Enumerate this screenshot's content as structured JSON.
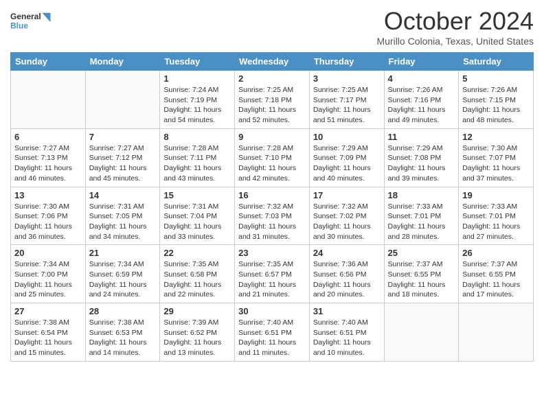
{
  "header": {
    "logo_general": "General",
    "logo_blue": "Blue",
    "month_title": "October 2024",
    "location": "Murillo Colonia, Texas, United States"
  },
  "days_of_week": [
    "Sunday",
    "Monday",
    "Tuesday",
    "Wednesday",
    "Thursday",
    "Friday",
    "Saturday"
  ],
  "weeks": [
    [
      {
        "day": null,
        "sunrise": null,
        "sunset": null,
        "daylight": null
      },
      {
        "day": null,
        "sunrise": null,
        "sunset": null,
        "daylight": null
      },
      {
        "day": "1",
        "sunrise": "Sunrise: 7:24 AM",
        "sunset": "Sunset: 7:19 PM",
        "daylight": "Daylight: 11 hours and 54 minutes."
      },
      {
        "day": "2",
        "sunrise": "Sunrise: 7:25 AM",
        "sunset": "Sunset: 7:18 PM",
        "daylight": "Daylight: 11 hours and 52 minutes."
      },
      {
        "day": "3",
        "sunrise": "Sunrise: 7:25 AM",
        "sunset": "Sunset: 7:17 PM",
        "daylight": "Daylight: 11 hours and 51 minutes."
      },
      {
        "day": "4",
        "sunrise": "Sunrise: 7:26 AM",
        "sunset": "Sunset: 7:16 PM",
        "daylight": "Daylight: 11 hours and 49 minutes."
      },
      {
        "day": "5",
        "sunrise": "Sunrise: 7:26 AM",
        "sunset": "Sunset: 7:15 PM",
        "daylight": "Daylight: 11 hours and 48 minutes."
      }
    ],
    [
      {
        "day": "6",
        "sunrise": "Sunrise: 7:27 AM",
        "sunset": "Sunset: 7:13 PM",
        "daylight": "Daylight: 11 hours and 46 minutes."
      },
      {
        "day": "7",
        "sunrise": "Sunrise: 7:27 AM",
        "sunset": "Sunset: 7:12 PM",
        "daylight": "Daylight: 11 hours and 45 minutes."
      },
      {
        "day": "8",
        "sunrise": "Sunrise: 7:28 AM",
        "sunset": "Sunset: 7:11 PM",
        "daylight": "Daylight: 11 hours and 43 minutes."
      },
      {
        "day": "9",
        "sunrise": "Sunrise: 7:28 AM",
        "sunset": "Sunset: 7:10 PM",
        "daylight": "Daylight: 11 hours and 42 minutes."
      },
      {
        "day": "10",
        "sunrise": "Sunrise: 7:29 AM",
        "sunset": "Sunset: 7:09 PM",
        "daylight": "Daylight: 11 hours and 40 minutes."
      },
      {
        "day": "11",
        "sunrise": "Sunrise: 7:29 AM",
        "sunset": "Sunset: 7:08 PM",
        "daylight": "Daylight: 11 hours and 39 minutes."
      },
      {
        "day": "12",
        "sunrise": "Sunrise: 7:30 AM",
        "sunset": "Sunset: 7:07 PM",
        "daylight": "Daylight: 11 hours and 37 minutes."
      }
    ],
    [
      {
        "day": "13",
        "sunrise": "Sunrise: 7:30 AM",
        "sunset": "Sunset: 7:06 PM",
        "daylight": "Daylight: 11 hours and 36 minutes."
      },
      {
        "day": "14",
        "sunrise": "Sunrise: 7:31 AM",
        "sunset": "Sunset: 7:05 PM",
        "daylight": "Daylight: 11 hours and 34 minutes."
      },
      {
        "day": "15",
        "sunrise": "Sunrise: 7:31 AM",
        "sunset": "Sunset: 7:04 PM",
        "daylight": "Daylight: 11 hours and 33 minutes."
      },
      {
        "day": "16",
        "sunrise": "Sunrise: 7:32 AM",
        "sunset": "Sunset: 7:03 PM",
        "daylight": "Daylight: 11 hours and 31 minutes."
      },
      {
        "day": "17",
        "sunrise": "Sunrise: 7:32 AM",
        "sunset": "Sunset: 7:02 PM",
        "daylight": "Daylight: 11 hours and 30 minutes."
      },
      {
        "day": "18",
        "sunrise": "Sunrise: 7:33 AM",
        "sunset": "Sunset: 7:01 PM",
        "daylight": "Daylight: 11 hours and 28 minutes."
      },
      {
        "day": "19",
        "sunrise": "Sunrise: 7:33 AM",
        "sunset": "Sunset: 7:01 PM",
        "daylight": "Daylight: 11 hours and 27 minutes."
      }
    ],
    [
      {
        "day": "20",
        "sunrise": "Sunrise: 7:34 AM",
        "sunset": "Sunset: 7:00 PM",
        "daylight": "Daylight: 11 hours and 25 minutes."
      },
      {
        "day": "21",
        "sunrise": "Sunrise: 7:34 AM",
        "sunset": "Sunset: 6:59 PM",
        "daylight": "Daylight: 11 hours and 24 minutes."
      },
      {
        "day": "22",
        "sunrise": "Sunrise: 7:35 AM",
        "sunset": "Sunset: 6:58 PM",
        "daylight": "Daylight: 11 hours and 22 minutes."
      },
      {
        "day": "23",
        "sunrise": "Sunrise: 7:35 AM",
        "sunset": "Sunset: 6:57 PM",
        "daylight": "Daylight: 11 hours and 21 minutes."
      },
      {
        "day": "24",
        "sunrise": "Sunrise: 7:36 AM",
        "sunset": "Sunset: 6:56 PM",
        "daylight": "Daylight: 11 hours and 20 minutes."
      },
      {
        "day": "25",
        "sunrise": "Sunrise: 7:37 AM",
        "sunset": "Sunset: 6:55 PM",
        "daylight": "Daylight: 11 hours and 18 minutes."
      },
      {
        "day": "26",
        "sunrise": "Sunrise: 7:37 AM",
        "sunset": "Sunset: 6:55 PM",
        "daylight": "Daylight: 11 hours and 17 minutes."
      }
    ],
    [
      {
        "day": "27",
        "sunrise": "Sunrise: 7:38 AM",
        "sunset": "Sunset: 6:54 PM",
        "daylight": "Daylight: 11 hours and 15 minutes."
      },
      {
        "day": "28",
        "sunrise": "Sunrise: 7:38 AM",
        "sunset": "Sunset: 6:53 PM",
        "daylight": "Daylight: 11 hours and 14 minutes."
      },
      {
        "day": "29",
        "sunrise": "Sunrise: 7:39 AM",
        "sunset": "Sunset: 6:52 PM",
        "daylight": "Daylight: 11 hours and 13 minutes."
      },
      {
        "day": "30",
        "sunrise": "Sunrise: 7:40 AM",
        "sunset": "Sunset: 6:51 PM",
        "daylight": "Daylight: 11 hours and 11 minutes."
      },
      {
        "day": "31",
        "sunrise": "Sunrise: 7:40 AM",
        "sunset": "Sunset: 6:51 PM",
        "daylight": "Daylight: 11 hours and 10 minutes."
      },
      {
        "day": null,
        "sunrise": null,
        "sunset": null,
        "daylight": null
      },
      {
        "day": null,
        "sunrise": null,
        "sunset": null,
        "daylight": null
      }
    ]
  ]
}
